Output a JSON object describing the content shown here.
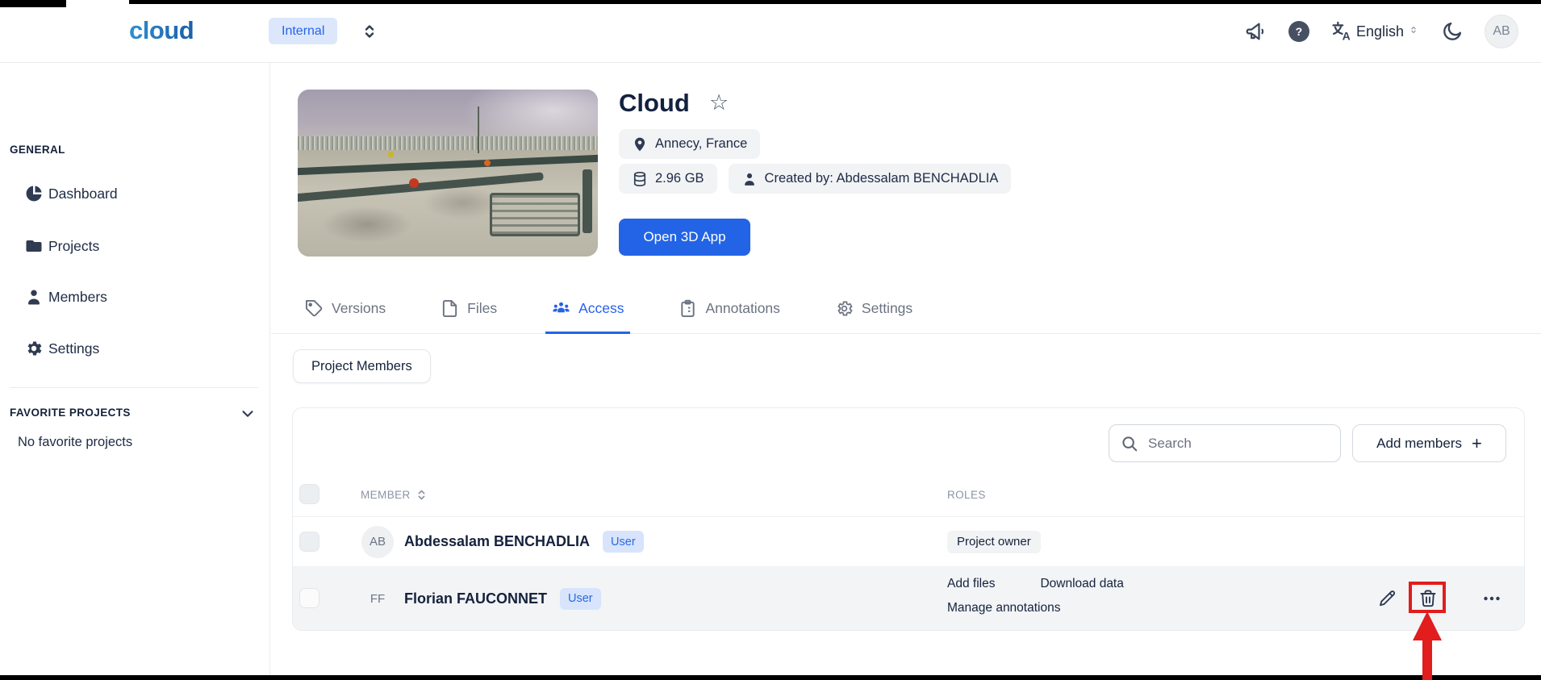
{
  "topbar": {
    "logo": "cloud",
    "environment_label": "Internal",
    "help_glyph": "?",
    "language_label": "English",
    "avatar_initials": "AB"
  },
  "sidebar": {
    "general_title": "GENERAL",
    "items": [
      {
        "label": "Dashboard"
      },
      {
        "label": "Projects"
      },
      {
        "label": "Members"
      },
      {
        "label": "Settings"
      }
    ],
    "favorites_title": "FAVORITE PROJECTS",
    "favorites_empty": "No favorite projects"
  },
  "project": {
    "title": "Cloud",
    "favorite_star": "☆",
    "location": "Annecy, France",
    "storage_size": "2.96 GB",
    "created_by": "Created by: Abdessalam BENCHADLIA",
    "open_app_label": "Open 3D App"
  },
  "tabs": [
    {
      "label": "Versions",
      "active": false
    },
    {
      "label": "Files",
      "active": false
    },
    {
      "label": "Access",
      "active": true
    },
    {
      "label": "Annotations",
      "active": false
    },
    {
      "label": "Settings",
      "active": false
    }
  ],
  "content": {
    "subtab_label": "Project Members"
  },
  "members_table": {
    "search_placeholder": "Search",
    "add_members_label": "Add members",
    "add_members_plus": "+",
    "columns": {
      "member": "MEMBER",
      "roles": "ROLES"
    },
    "rows": [
      {
        "initials": "AB",
        "name": "Abdessalam BENCHADLIA",
        "account_type": "User",
        "roles_badge": "Project owner"
      },
      {
        "initials": "FF",
        "name": "Florian FAUCONNET",
        "account_type": "User",
        "roles_line1": [
          "Add files",
          "Download data"
        ],
        "roles_line2": "Manage annotations"
      }
    ]
  },
  "colors": {
    "accent_blue": "#2563eb",
    "button_blue": "#2264e5",
    "badge_blue_bg": "#d7e4fc",
    "badge_gray_bg": "#f1f3f5",
    "row_highlight": "#f2f4f6",
    "annotation_red": "#e11d1d"
  }
}
